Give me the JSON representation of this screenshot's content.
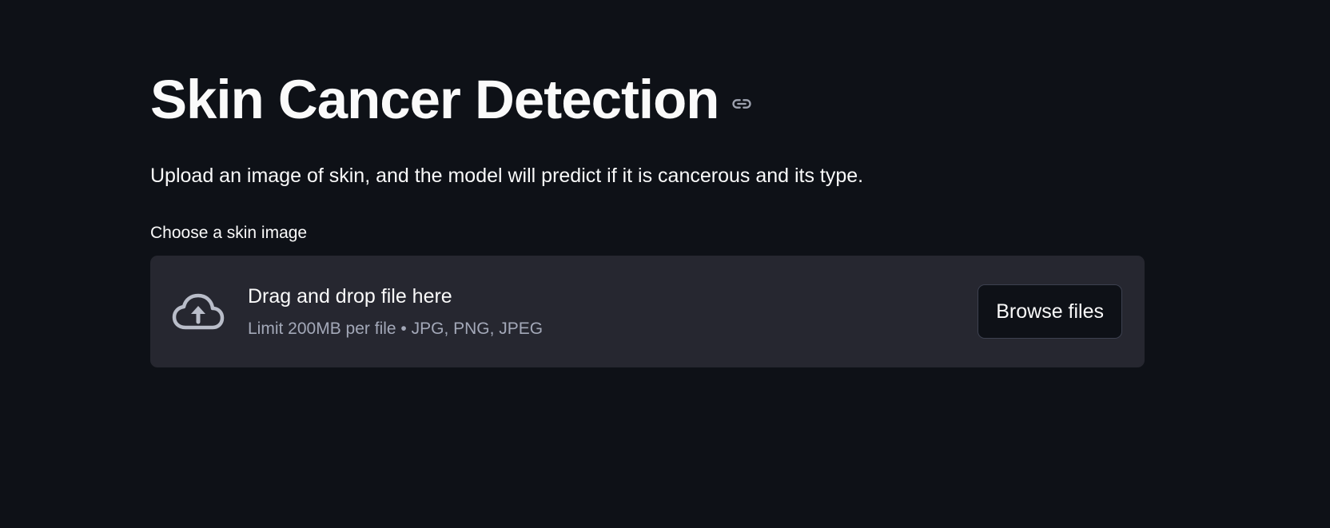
{
  "header": {
    "title": "Skin Cancer Detection",
    "anchor_icon": "link-icon"
  },
  "main": {
    "description": "Upload an image of skin, and the model will predict if it is cancerous and its type."
  },
  "uploader": {
    "label": "Choose a skin image",
    "icon": "cloud-upload-icon",
    "dropzone_title": "Drag and drop file here",
    "dropzone_hint": "Limit 200MB per file • JPG, PNG, JPEG",
    "browse_label": "Browse files"
  },
  "colors": {
    "background": "#0e1117",
    "dropzone_background": "#262730",
    "text": "#fafafa",
    "hint_text": "#a3a8b8"
  }
}
